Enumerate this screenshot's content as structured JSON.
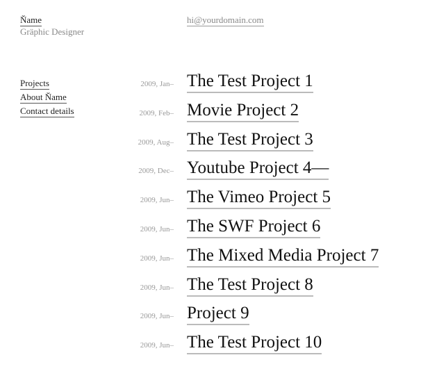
{
  "header": {
    "name": "Ňame",
    "tagline": "Gräphic Designer",
    "email": "hi@yourdomain.com"
  },
  "nav": {
    "items": [
      {
        "label": "Projects"
      },
      {
        "label": "About Ňame"
      },
      {
        "label": "Contact details"
      }
    ]
  },
  "projects": [
    {
      "date": "2009, Jan–",
      "title": "The Test Project 1"
    },
    {
      "date": "2009, Feb–",
      "title": "Movie Project 2"
    },
    {
      "date": "2009, Aug–",
      "title": "The Test Project 3"
    },
    {
      "date": "2009, Dec–",
      "title": "Youtube Project 4—"
    },
    {
      "date": "2009, Jun–",
      "title": "The Vimeo Project 5"
    },
    {
      "date": "2009, Jun–",
      "title": "The SWF Project 6"
    },
    {
      "date": "2009, Jun–",
      "title": "The Mixed Media Project 7"
    },
    {
      "date": "2009, Jun–",
      "title": "The Test Project 8"
    },
    {
      "date": "2009, Jun–",
      "title": "Project 9"
    },
    {
      "date": "2009, Jun–",
      "title": "The Test Project 10"
    }
  ],
  "colors": {
    "text": "#222222",
    "muted": "#888888",
    "date": "#999999",
    "underline": "#bbbbbb"
  }
}
